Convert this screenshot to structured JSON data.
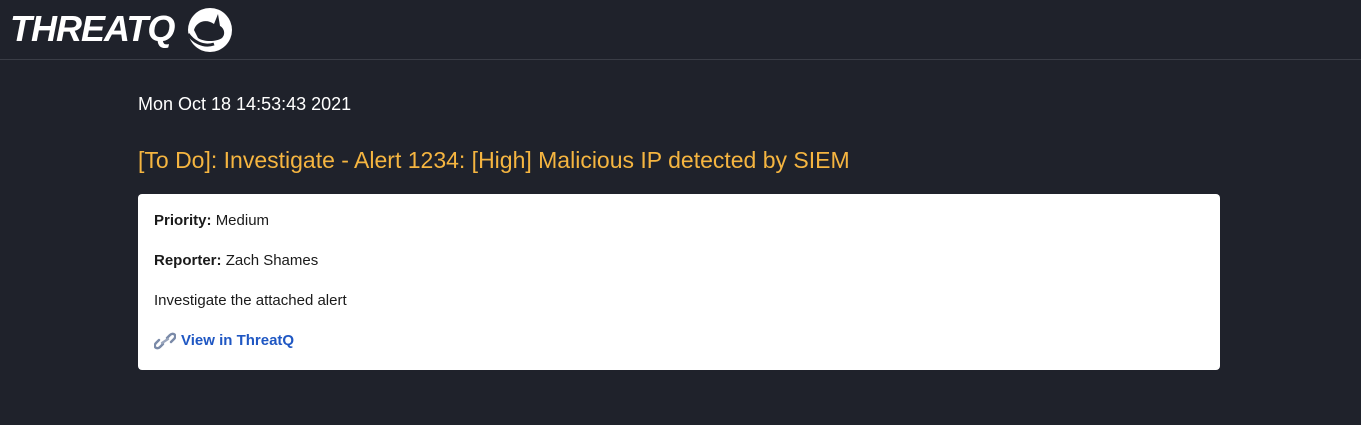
{
  "header": {
    "logo_text": "THREATQ"
  },
  "email": {
    "date": "Mon Oct 18 14:53:43 2021",
    "subject": "[To Do]: Investigate - Alert 1234: [High] Malicious IP detected by SIEM",
    "priority_label": "Priority:",
    "priority_value": "Medium",
    "reporter_label": "Reporter:",
    "reporter_value": "Zach Shames",
    "description": "Investigate the attached alert",
    "link_icon": "link-icon",
    "link_text": "View in ThreatQ"
  },
  "colors": {
    "background": "#1f222b",
    "title": "#f5b540",
    "link": "#1f57c3"
  }
}
